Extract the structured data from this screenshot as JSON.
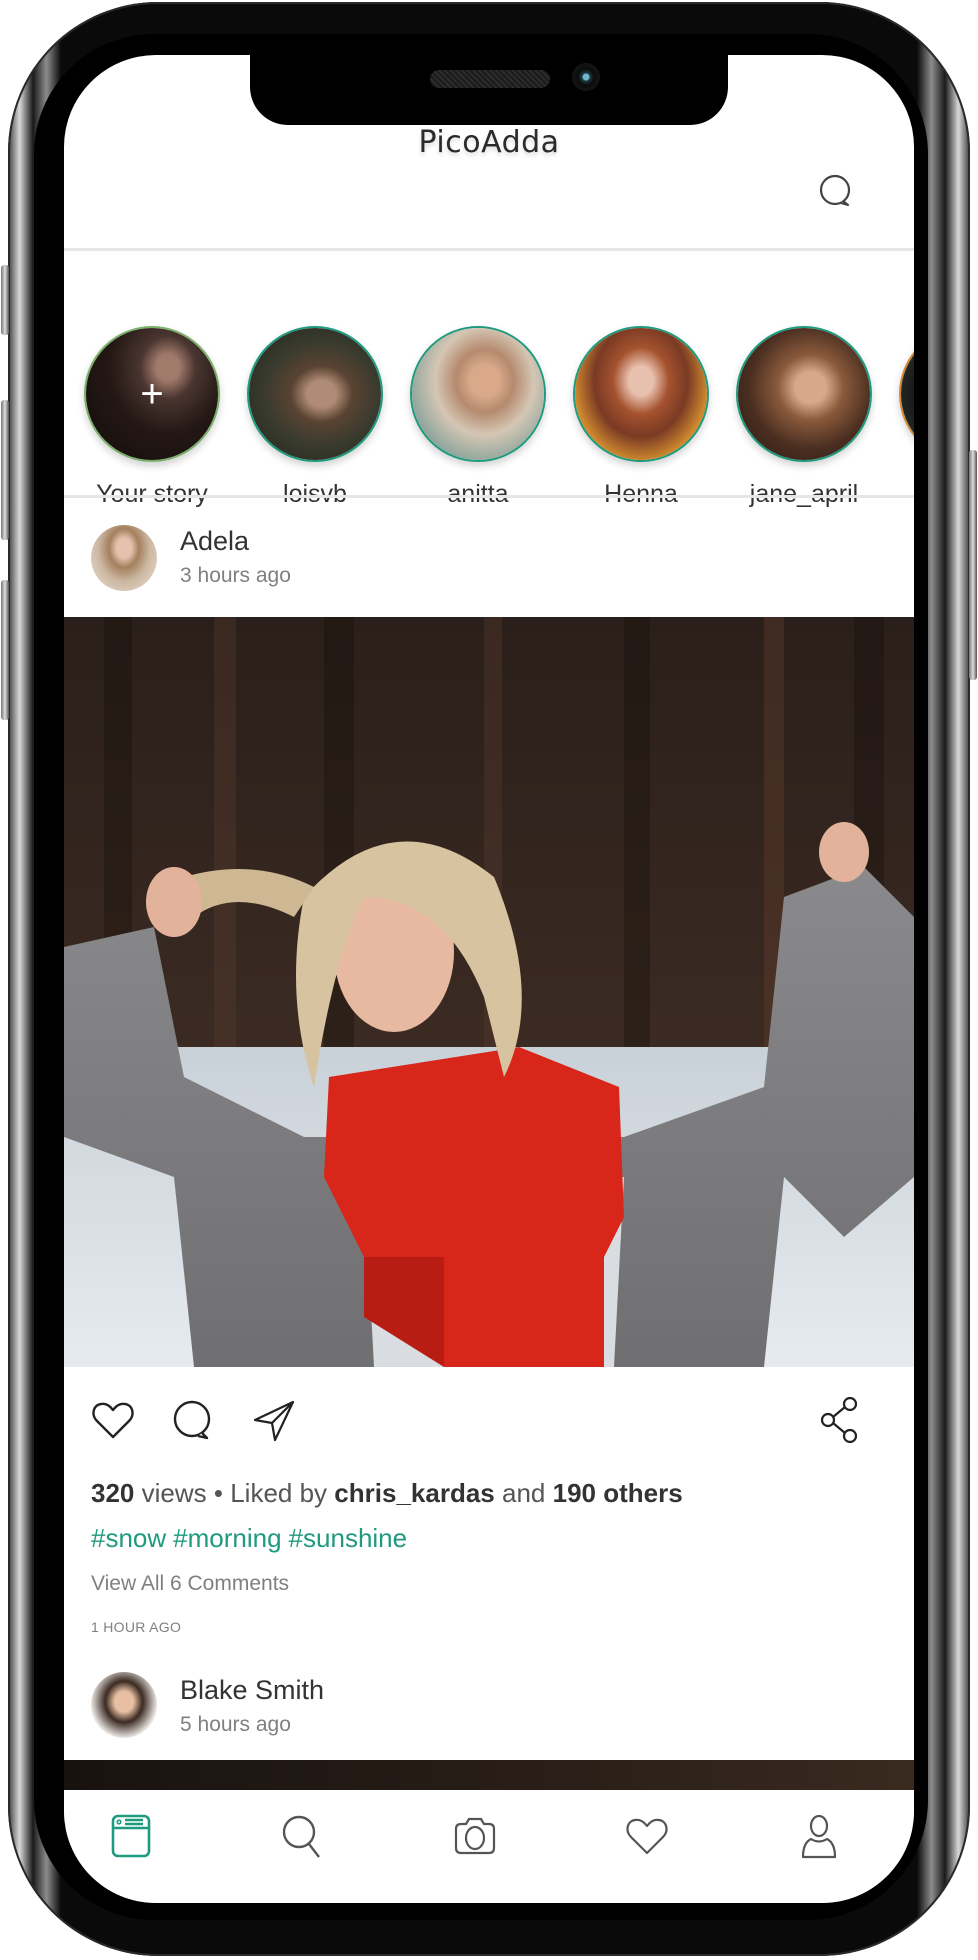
{
  "app": {
    "title": "PicoAdda",
    "accent_color": "#1f9a7e"
  },
  "header": {
    "logo_text": "PicoAdda",
    "messages_icon": "chat-bubble-icon"
  },
  "stories": [
    {
      "label": "Your story",
      "own": true,
      "add_icon": "+"
    },
    {
      "label": "loisvb"
    },
    {
      "label": "anitta"
    },
    {
      "label": "Henna"
    },
    {
      "label": "jane_april"
    }
  ],
  "posts": [
    {
      "author": "Adela",
      "time": "3 hours ago",
      "views_count": "320",
      "views_label": "views",
      "separator": "•",
      "liked_by_prefix": "Liked by",
      "liked_by_user": "chris_kardas",
      "liked_by_joiner": "and",
      "others": "190 others",
      "hashtags": [
        "#snow",
        "#morning",
        "#sunshine"
      ],
      "view_comments": "View All 6 Comments",
      "posted_ago": "1 HOUR AGO"
    },
    {
      "author": "Blake Smith",
      "time": "5 hours ago"
    }
  ],
  "actions": {
    "like": "heart-icon",
    "comment": "comment-icon",
    "send": "send-icon",
    "share": "share-icon"
  },
  "tabbar": {
    "active": "feed",
    "items": [
      {
        "id": "feed",
        "icon": "feed-icon"
      },
      {
        "id": "search",
        "icon": "search-icon"
      },
      {
        "id": "camera",
        "icon": "camera-icon"
      },
      {
        "id": "activity",
        "icon": "heart-icon"
      },
      {
        "id": "profile",
        "icon": "profile-icon"
      }
    ]
  }
}
